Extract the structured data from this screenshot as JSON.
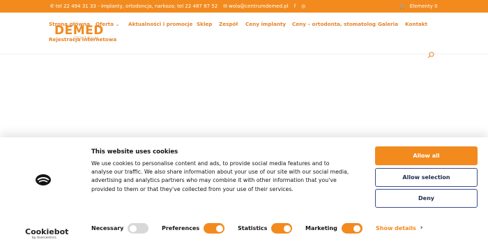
{
  "topbar": {
    "phone1": "tel 22 494 31 33 - implanty, ortodoncja, narkoza; tel 22 487 87 52",
    "email": "wola@centrumdemed.pl",
    "facebook": "f",
    "instagram": "◎",
    "cart": "Elementy 0"
  },
  "header": {
    "logo": "DEMED",
    "logo_sub": "CENTRUM",
    "nav": [
      {
        "label": "Strona główna"
      },
      {
        "label": "Oferta",
        "dropdown": "⌄"
      },
      {
        "label": "Aktualności i promocje"
      },
      {
        "label": "Sklep"
      },
      {
        "label": "Zespół"
      },
      {
        "label": "Ceny implanty"
      },
      {
        "label": "Ceny – ortodonta, stomatolog"
      },
      {
        "label": "Galeria"
      },
      {
        "label": "Kontakt"
      }
    ],
    "nav_row2": "Rejestracja internetowa"
  },
  "cookie": {
    "title": "This website uses cookies",
    "description": "We use cookies to personalise content and ads, to provide social media features and to analyse our traffic. We also share information about your use of our site with our social media, advertising and analytics partners who may combine it with other information that you've provided to them or that they've collected from your use of their services.",
    "buttons": {
      "allow_all": "Allow all",
      "allow_selection": "Allow selection",
      "deny": "Deny"
    },
    "consents": [
      {
        "label": "Necessary",
        "state": "disabled-on"
      },
      {
        "label": "Preferences",
        "state": "on"
      },
      {
        "label": "Statistics",
        "state": "on"
      },
      {
        "label": "Marketing",
        "state": "on"
      }
    ],
    "show_details": "Show details",
    "brand": "Cookiebot",
    "brand_sub": "by Usercentrics"
  },
  "colors": {
    "accent": "#f28a1e",
    "outline": "#3b4b8f"
  }
}
